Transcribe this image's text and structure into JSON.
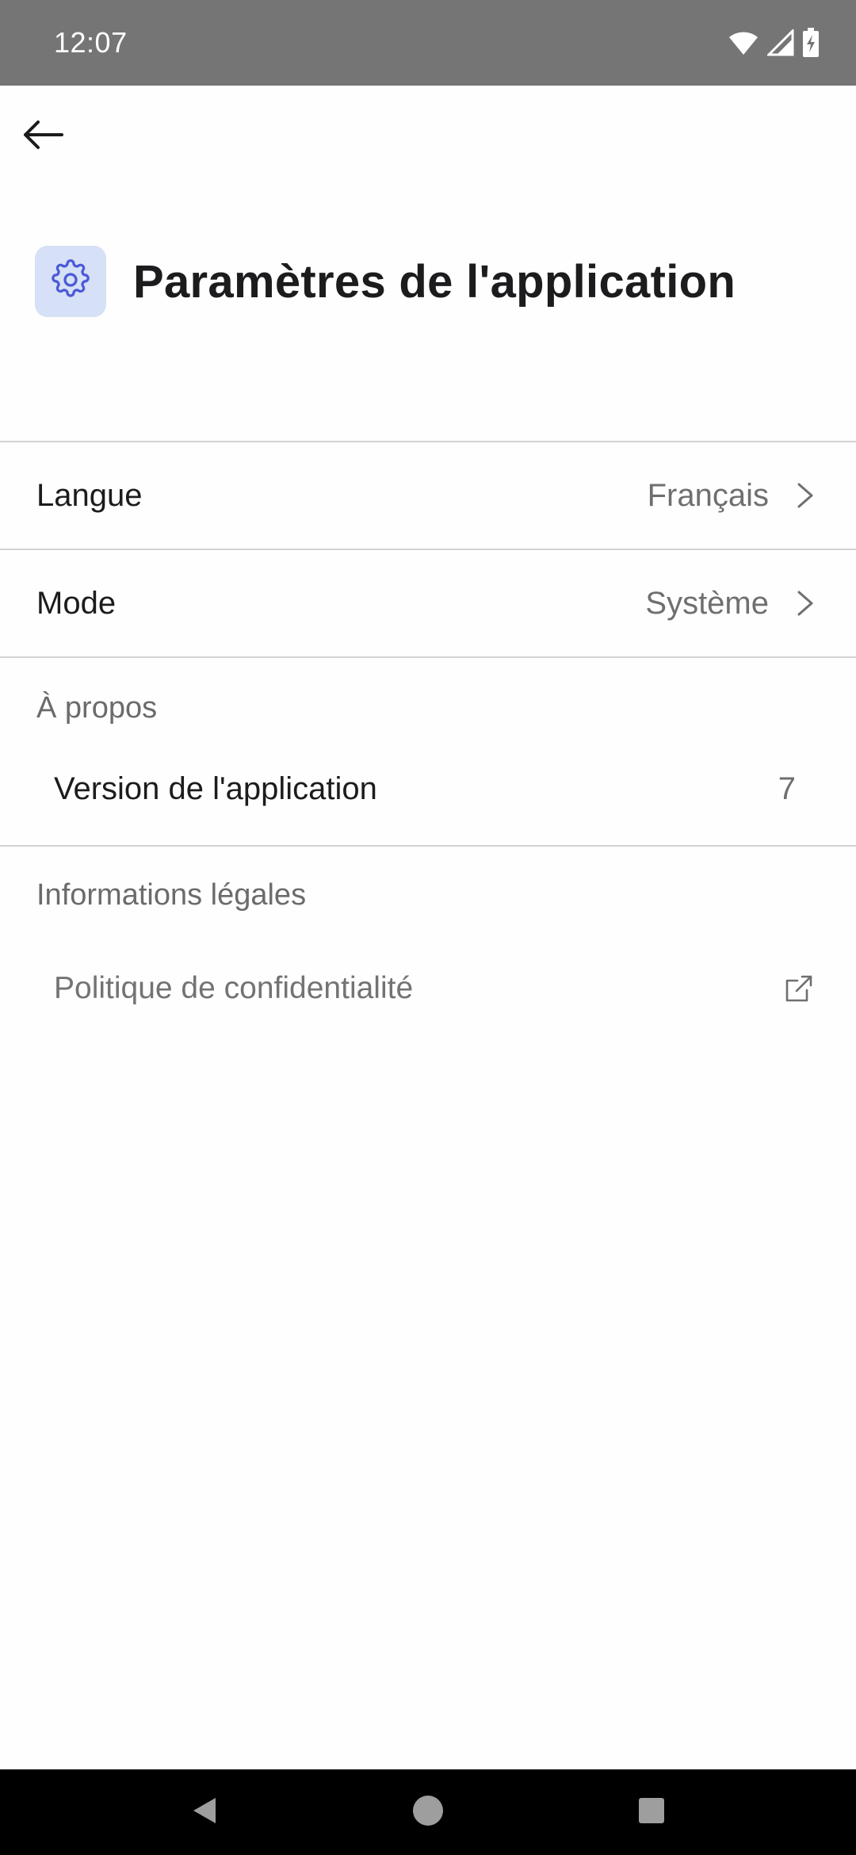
{
  "status_bar": {
    "time": "12:07",
    "icons": [
      "wifi-icon",
      "signal-icon",
      "battery-charging-icon"
    ]
  },
  "top_bar": {
    "back_icon": "arrow-left-icon"
  },
  "header": {
    "icon": "gear-icon",
    "title": "Paramètres de l'application"
  },
  "settings": {
    "language": {
      "label": "Langue",
      "value": "Français"
    },
    "mode": {
      "label": "Mode",
      "value": "Système"
    }
  },
  "about": {
    "section_title": "À propos",
    "version_label": "Version de l'application",
    "version_value": "7"
  },
  "legal": {
    "section_title": "Informations légales",
    "privacy_label": "Politique de confidentialité",
    "privacy_icon": "external-link-icon"
  },
  "colors": {
    "status_bar": "#757575",
    "accent": "#4a5ad6",
    "icon_box": "#d6e0f6",
    "divider": "#d3d3d3",
    "secondary_text": "#6f6f6f"
  }
}
